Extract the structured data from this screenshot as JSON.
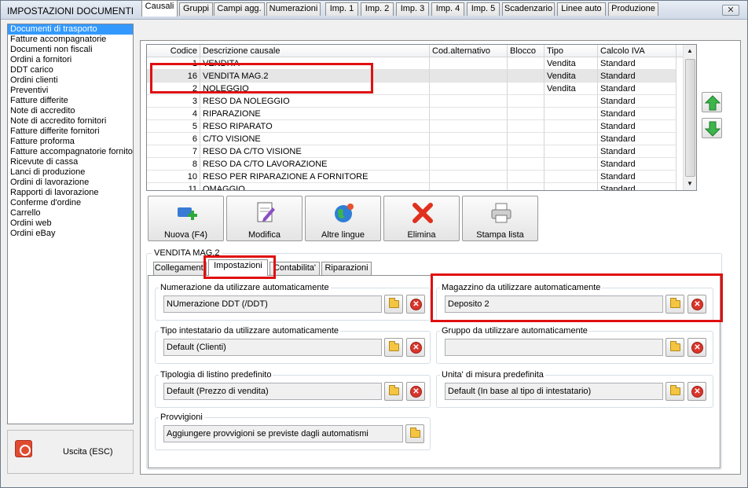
{
  "window": {
    "title": "IMPOSTAZIONI DOCUMENTI",
    "close_label": "✕"
  },
  "left_list": {
    "items": [
      "Documenti di trasporto",
      "Fatture accompagnatorie",
      "Documenti non fiscali",
      "Ordini a fornitori",
      "DDT carico",
      "Ordini clienti",
      "Preventivi",
      "Fatture differite",
      "Note di accredito",
      "Note di accredito fornitori",
      "Fatture differite fornitori",
      "Fatture proforma",
      "Fatture accompagnatorie fornito",
      "Ricevute di cassa",
      "Lanci di produzione",
      "Ordini di lavorazione",
      "Rapporti di lavorazione",
      "Conferme d'ordine",
      "Carrello",
      "Ordini web",
      "Ordini eBay"
    ],
    "selected_index": 0
  },
  "exit": {
    "label": "Uscita (ESC)"
  },
  "tabs": [
    "Causali",
    "Gruppi",
    "Campi agg.",
    "Numerazioni",
    "Imp. 1",
    "Imp. 2",
    "Imp. 3",
    "Imp. 4",
    "Imp. 5",
    "Scadenzario",
    "Linee auto",
    "Produzione"
  ],
  "grid": {
    "headers": [
      "Codice",
      "Descrizione causale",
      "Cod.alternativo",
      "Blocco",
      "Tipo",
      "Calcolo IVA"
    ],
    "rows": [
      [
        "1",
        "VENDITA",
        "",
        "",
        "Vendita",
        "Standard"
      ],
      [
        "16",
        "VENDITA MAG.2",
        "",
        "",
        "Vendita",
        "Standard"
      ],
      [
        "2",
        "NOLEGGIO",
        "",
        "",
        "Vendita",
        "Standard"
      ],
      [
        "3",
        "RESO DA NOLEGGIO",
        "",
        "",
        "",
        "Standard"
      ],
      [
        "4",
        "RIPARAZIONE",
        "",
        "",
        "",
        "Standard"
      ],
      [
        "5",
        "RESO RIPARATO",
        "",
        "",
        "",
        "Standard"
      ],
      [
        "6",
        "C/TO VISIONE",
        "",
        "",
        "",
        "Standard"
      ],
      [
        "7",
        "RESO DA C/TO VISIONE",
        "",
        "",
        "",
        "Standard"
      ],
      [
        "8",
        "RESO DA C/TO LAVORAZIONE",
        "",
        "",
        "",
        "Standard"
      ],
      [
        "10",
        "RESO PER RIPARAZIONE A FORNITORE",
        "",
        "",
        "",
        "Standard"
      ],
      [
        "11",
        "OMAGGIO",
        "",
        "",
        "",
        "Standard"
      ]
    ],
    "selected_index": 1
  },
  "toolbar": {
    "new_label": "Nuova (F4)",
    "edit_label": "Modifica",
    "lang_label": "Altre lingue",
    "delete_label": "Elimina",
    "print_label": "Stampa lista"
  },
  "detail": {
    "group_label": "VENDITA MAG.2",
    "tabs": [
      "Collegamenti",
      "Impostazioni",
      "Contabilita'",
      "Riparazioni"
    ],
    "fields": {
      "numerazione": {
        "label": "Numerazione da utilizzare automaticamente",
        "value": "NUmerazione DDT (/DDT)"
      },
      "magazzino": {
        "label": "Magazzino da utilizzare automaticamente",
        "value": "Deposito 2"
      },
      "tipo_intestatario": {
        "label": "Tipo intestatario da utilizzare automaticamente",
        "value": "Default (Clienti)"
      },
      "gruppo": {
        "label": "Gruppo da utilizzare automaticamente",
        "value": ""
      },
      "listino": {
        "label": "Tipologia di listino predefinito",
        "value": "Default (Prezzo di vendita)"
      },
      "unita": {
        "label": "Unita' di misura predefinita",
        "value": "Default (In base al tipo di intestatario)"
      },
      "provvigioni": {
        "label": "Provvigioni",
        "value": "Aggiungere provvigioni se previste dagli automatismi"
      }
    }
  }
}
